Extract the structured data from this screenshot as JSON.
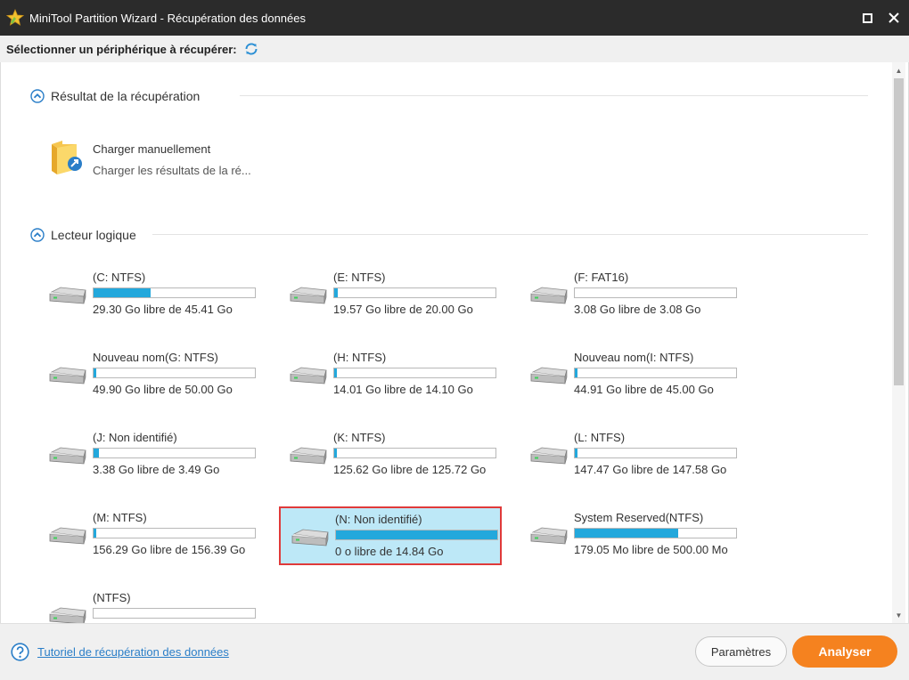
{
  "window": {
    "title": "MiniTool Partition Wizard - Récupération des données",
    "maximize_icon": "maximize-icon",
    "close_icon": "close-icon"
  },
  "subheader": {
    "label": "Sélectionner un périphérique à récupérer:",
    "refresh_icon": "refresh-icon"
  },
  "recovery_result": {
    "title": "Résultat de la récupération",
    "manual_load": {
      "title": "Charger manuellement",
      "subtitle": "Charger les résultats de la ré..."
    }
  },
  "logical_drives": {
    "title": "Lecteur logique",
    "drives": [
      {
        "name": "(C: NTFS)",
        "info": "29.30 Go libre de 45.41 Go",
        "used_fraction": 0.355
      },
      {
        "name": "(E: NTFS)",
        "info": "19.57 Go libre de 20.00 Go",
        "used_fraction": 0.022
      },
      {
        "name": "(F: FAT16)",
        "info": "3.08 Go libre de 3.08 Go",
        "used_fraction": 0.0
      },
      {
        "name": "Nouveau nom(G: NTFS)",
        "info": "49.90 Go libre de 50.00 Go",
        "used_fraction": 0.002
      },
      {
        "name": "(H: NTFS)",
        "info": "14.01 Go libre de 14.10 Go",
        "used_fraction": 0.006
      },
      {
        "name": "Nouveau nom(I: NTFS)",
        "info": "44.91 Go libre de 45.00 Go",
        "used_fraction": 0.002
      },
      {
        "name": "(J: Non identifié)",
        "info": "3.38 Go libre de 3.49 Go",
        "used_fraction": 0.032
      },
      {
        "name": "(K: NTFS)",
        "info": "125.62 Go libre de 125.72 Go",
        "used_fraction": 0.001
      },
      {
        "name": "(L: NTFS)",
        "info": "147.47 Go libre de 147.58 Go",
        "used_fraction": 0.001
      },
      {
        "name": "(M: NTFS)",
        "info": "156.29 Go libre de 156.39 Go",
        "used_fraction": 0.001
      },
      {
        "name": "(N: Non identifié)",
        "info": "0 o libre de 14.84 Go",
        "used_fraction": 1.0,
        "selected": true
      },
      {
        "name": "System Reserved(NTFS)",
        "info": "179.05 Mo libre de 500.00 Mo",
        "used_fraction": 0.642
      },
      {
        "name": "(NTFS)",
        "info": "",
        "used_fraction": 0.0
      }
    ]
  },
  "footer": {
    "tutorial_link": "Tutoriel de récupération des données",
    "params_button": "Paramètres",
    "analyze_button": "Analyser"
  },
  "colors": {
    "accent_orange": "#f5821f",
    "bar_blue": "#23a8dc",
    "selected_bg": "#bde8f7",
    "selected_border": "#e03a3a",
    "titlebar": "#2b2b2b"
  }
}
